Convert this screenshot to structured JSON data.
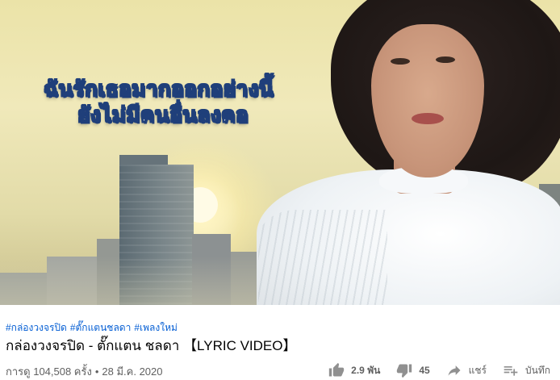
{
  "video": {
    "lyric_lines": [
      "ฉันรักเธอมากออกอย่างนี้",
      "ยังไม่มีคนอื่นลงคอ"
    ]
  },
  "hashtags": [
    "#กล่องวงจรปิด",
    "#ตั๊กแตนชลดา",
    "#เพลงใหม่"
  ],
  "title": "กล่องวงจรปิด - ตั๊กแตน ชลดา 【LYRIC VIDEO】",
  "meta": {
    "views": "การดู 104,508 ครั้ง",
    "separator": "•",
    "date": "28 มี.ค. 2020"
  },
  "actions": {
    "like_count": "2.9 พัน",
    "dislike_count": "45",
    "share_label": "แชร์",
    "save_label": "บันทึก"
  },
  "colors": {
    "link": "#065fd4",
    "text_primary": "#030303",
    "text_secondary": "#606060",
    "lyric_outline": "#1f3f7a"
  },
  "icons": [
    "thumb-up-icon",
    "thumb-down-icon",
    "share-icon",
    "playlist-add-icon"
  ]
}
